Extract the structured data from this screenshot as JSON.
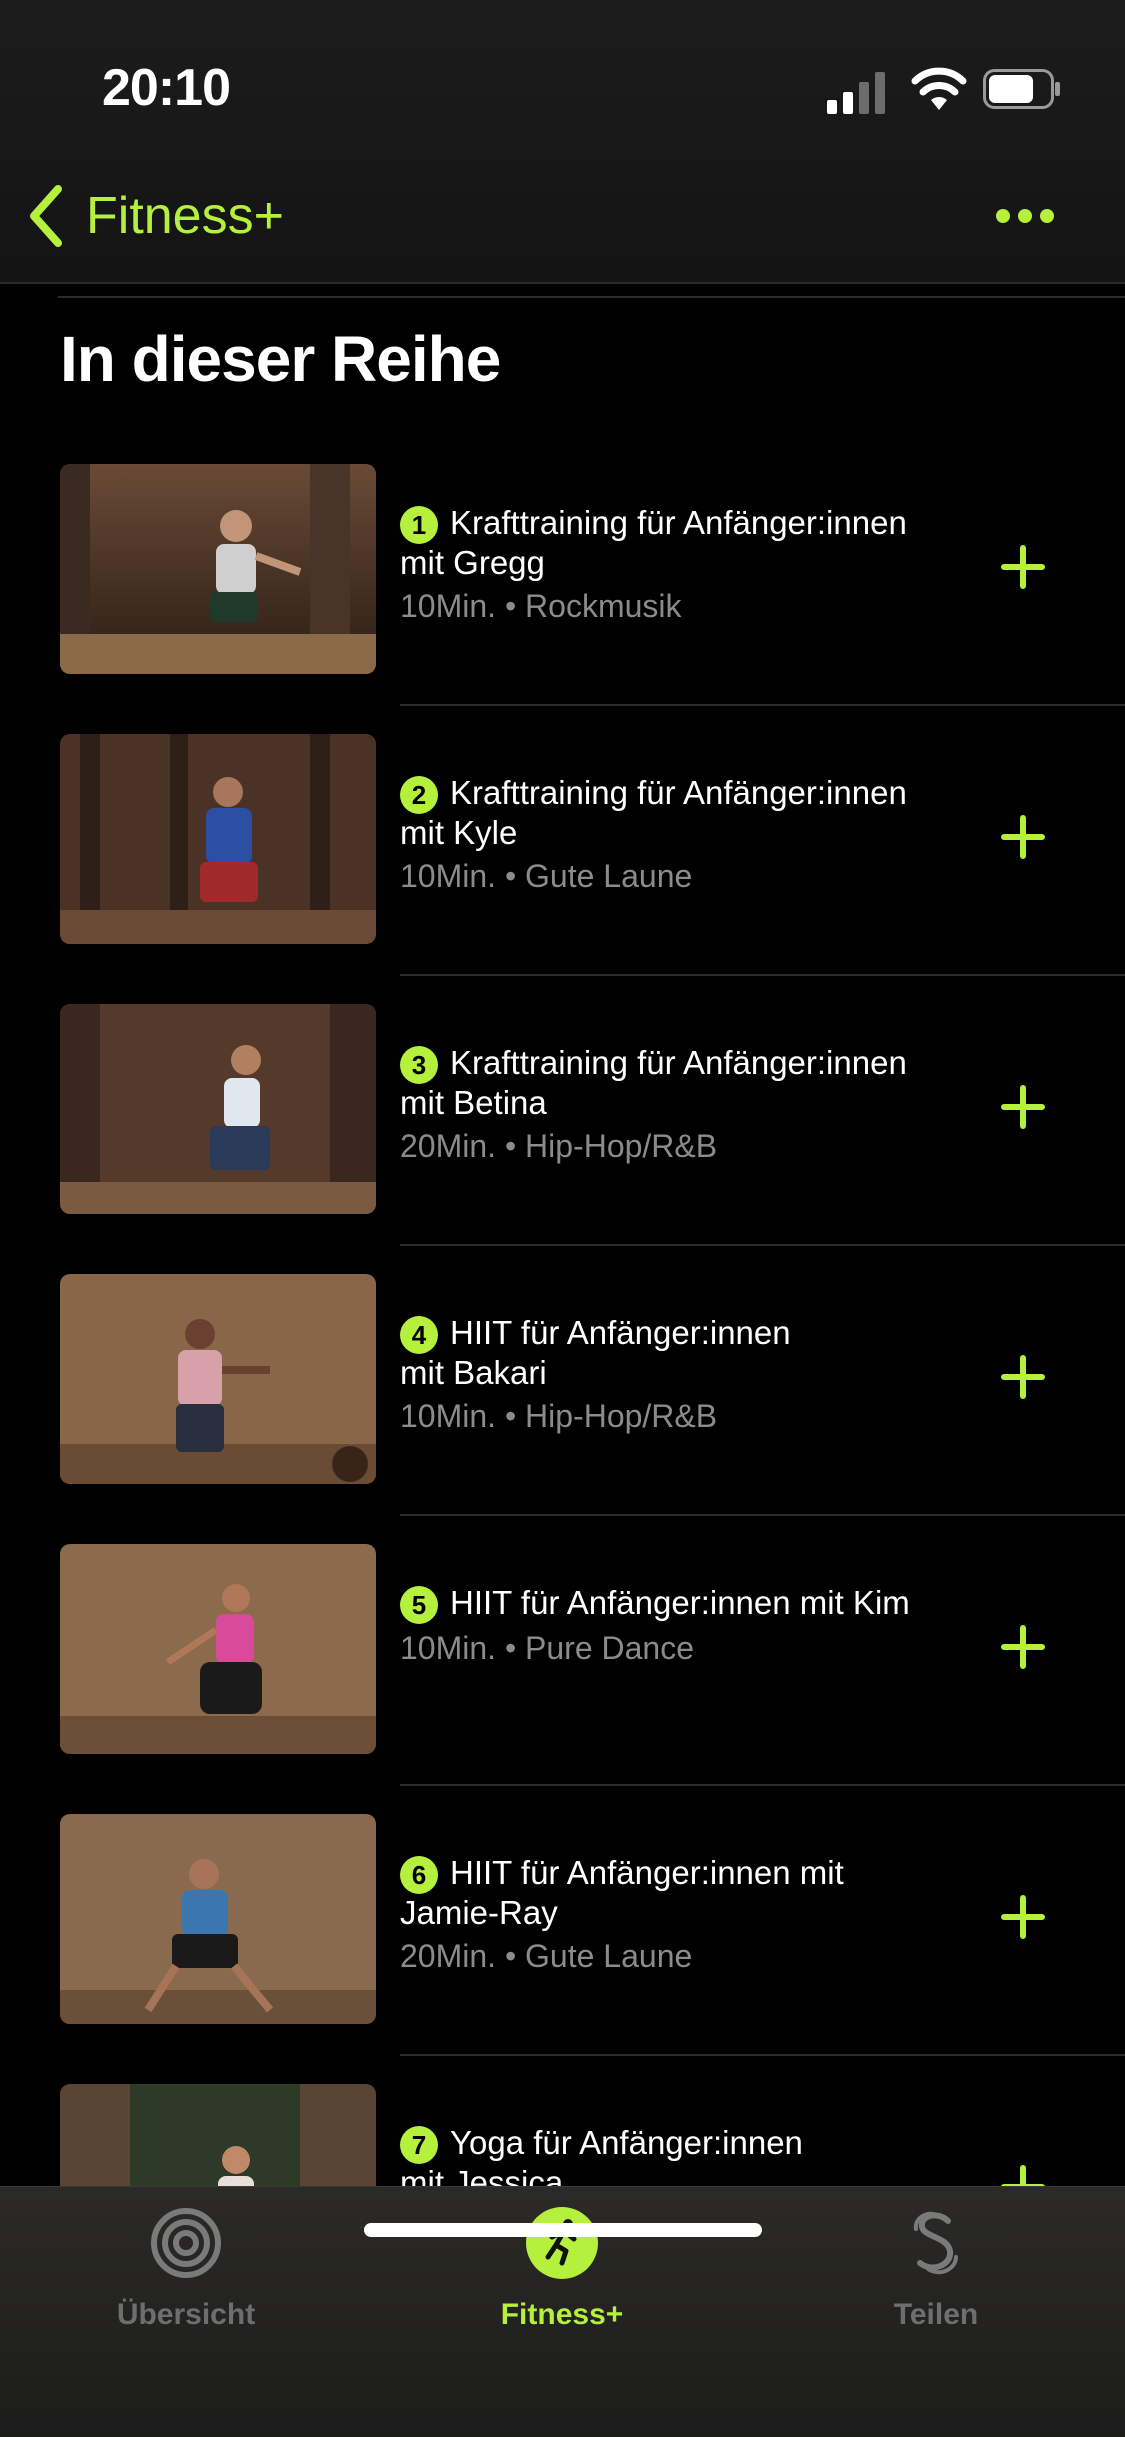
{
  "status": {
    "time": "20:10"
  },
  "nav": {
    "back_label": "Fitness+"
  },
  "section": {
    "title": "In dieser Reihe"
  },
  "items": [
    {
      "number": "1",
      "title": "Krafttraining für Anfänger:innen",
      "title2": "mit Gregg",
      "meta": "10Min. • Rockmusik"
    },
    {
      "number": "2",
      "title": "Krafttraining für Anfänger:innen",
      "title2": "mit Kyle",
      "meta": "10Min. • Gute Laune"
    },
    {
      "number": "3",
      "title": "Krafttraining für Anfänger:innen",
      "title2": "mit Betina",
      "meta": "20Min. • Hip-Hop/R&B"
    },
    {
      "number": "4",
      "title": "HIIT für Anfänger:innen",
      "title2": "mit Bakari",
      "meta": "10Min. • Hip-Hop/R&B"
    },
    {
      "number": "5",
      "title": "HIIT für Anfänger:innen mit Kim",
      "title2": "",
      "meta": "10Min. • Pure Dance"
    },
    {
      "number": "6",
      "title": "HIIT für Anfänger:innen mit",
      "title2": "Jamie-Ray",
      "meta": "20Min. • Gute Laune"
    },
    {
      "number": "7",
      "title": "Yoga für Anfänger:innen",
      "title2": "mit Jessica",
      "meta": ""
    }
  ],
  "tabs": [
    {
      "label": "Übersicht",
      "icon": "activity-rings-icon"
    },
    {
      "label": "Fitness+",
      "icon": "running-figure-icon"
    },
    {
      "label": "Teilen",
      "icon": "sharing-icon"
    }
  ],
  "colors": {
    "accent": "#b4f03c",
    "background": "#000000"
  }
}
